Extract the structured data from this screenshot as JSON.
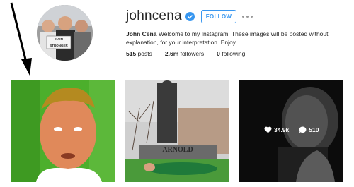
{
  "profile": {
    "username": "johncena",
    "follow_label": "FOLLOW",
    "full_name": "John Cena",
    "bio": " Welcome to my Instagram. These images will be posted without explanation, for your interpretation. Enjoy.",
    "posts_count": "515",
    "posts_label": " posts",
    "followers_count": "2.6m",
    "followers_label": " followers",
    "following_count": "0",
    "following_label": " following",
    "avatar_sign_text": "EVEN\nSTRONGER"
  },
  "posts": [
    {
      "description": "close-up face photo with green background"
    },
    {
      "description": "statue photo with person lying on grass",
      "statue_plaque": "ARNOLD"
    },
    {
      "description": "black and white portrait",
      "likes": "34.9k",
      "comments": "510"
    }
  ],
  "colors": {
    "accent": "#3897f0",
    "text": "#262626"
  }
}
